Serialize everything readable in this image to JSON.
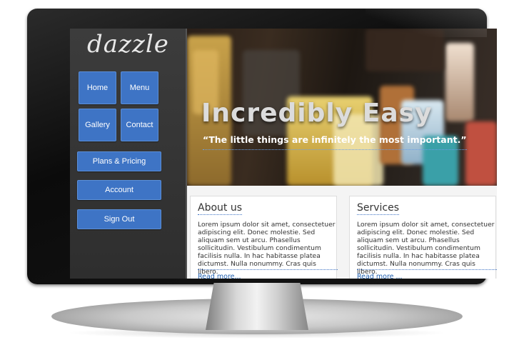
{
  "brand": {
    "logo_text": "dazzle"
  },
  "nav": {
    "home": "Home",
    "menu": "Menu",
    "gallery": "Gallery",
    "contact": "Contact",
    "plans": "Plans & Pricing",
    "account": "Account",
    "signout": "Sign Out"
  },
  "hero": {
    "title": "Incredibly Easy",
    "quote": "“The little things are infinitely the most important.”"
  },
  "cards": [
    {
      "title": "About us",
      "text": "Lorem ipsum dolor sit amet, consectetuer adipiscing elit. Donec molestie. Sed aliquam sem ut arcu. Phasellus sollicitudin. Vestibulum condimentum facilisis nulla. In hac habitasse platea dictumst. Nulla nonummy. Cras quis libero.",
      "link": "Read more..."
    },
    {
      "title": "Services",
      "text": "Lorem ipsum dolor sit amet, consectetuer adipiscing elit. Donec molestie. Sed aliquam sem ut arcu. Phasellus sollicitudin. Vestibulum condimentum facilisis nulla. In hac habitasse platea dictumst. Nulla nonummy. Cras quis libero.",
      "link": "Read more ..."
    }
  ],
  "colors": {
    "button": "#3e74c5",
    "link": "#1f5fb0",
    "sidebar": "#333333"
  }
}
